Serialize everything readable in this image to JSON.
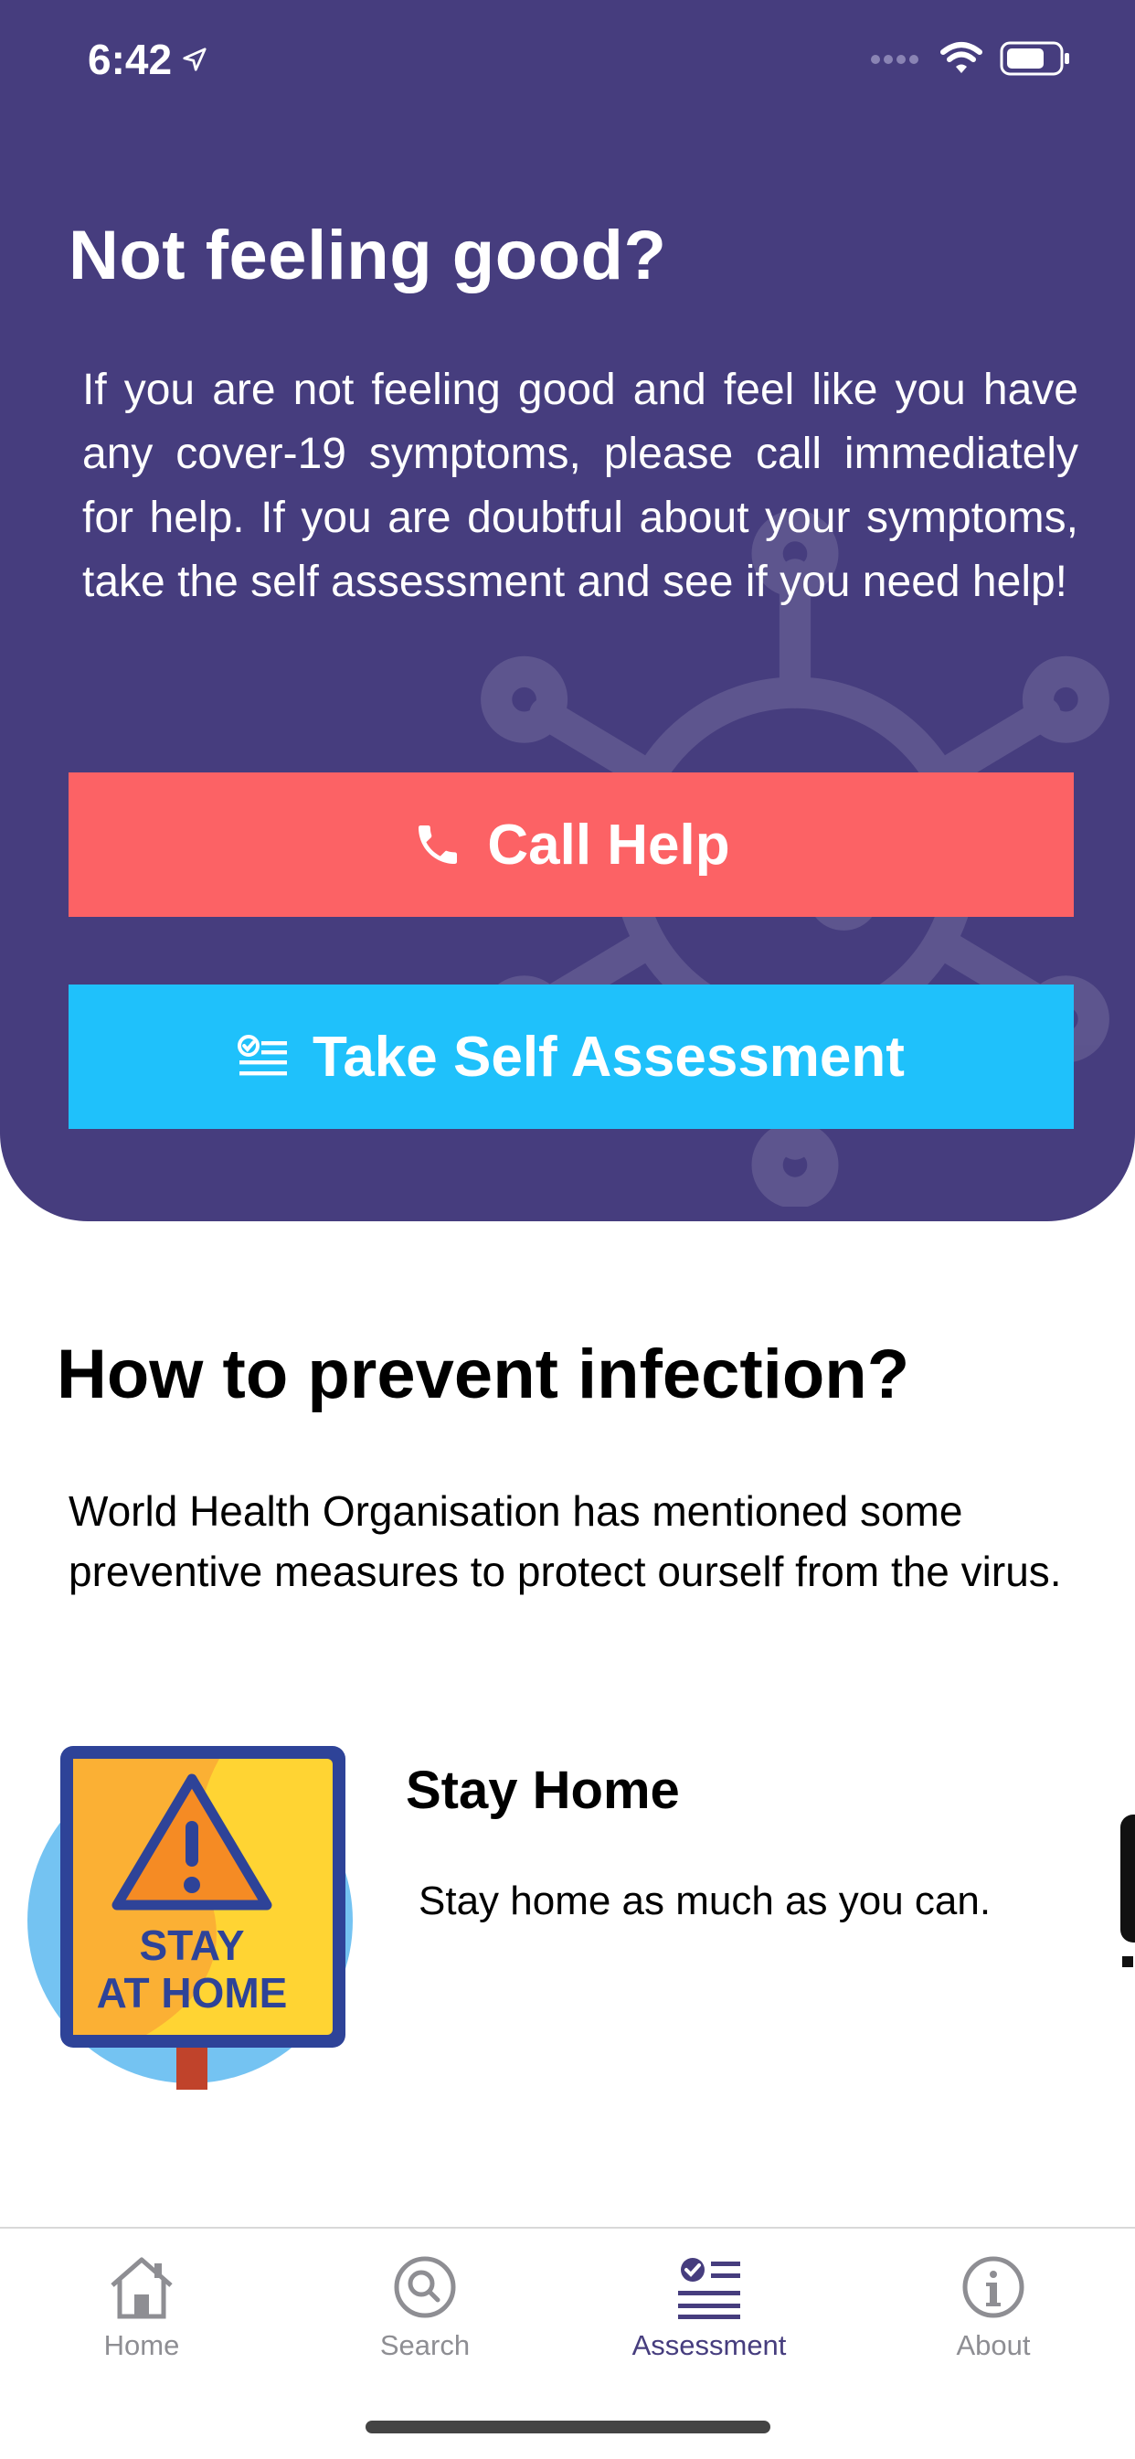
{
  "status_bar": {
    "time": "6:42"
  },
  "hero": {
    "title": "Not feeling good?",
    "description": "If you are not feeling good and feel like you have any cover-19 symptoms, please call immediately for help. If you are doubtful about your symptoms, take the self assessment and see if you need help!",
    "call_button": "Call Help",
    "assess_button": "Take Self Assessment",
    "colors": {
      "background": "#463d7e",
      "call": "#fc6265",
      "assess": "#1fc1fb"
    }
  },
  "prevention": {
    "title": "How to prevent infection?",
    "description": "World Health Organisation has mentioned some preventive measures to protect ourself from the virus.",
    "cards": [
      {
        "title": "Stay Home",
        "text": "Stay home as much as you can.",
        "sign_line1": "STAY",
        "sign_line2": "AT HOME",
        "icon": "stay-at-home-sign-icon"
      }
    ]
  },
  "tabs": [
    {
      "label": "Home",
      "icon": "home-icon",
      "active": false
    },
    {
      "label": "Search",
      "icon": "search-icon",
      "active": false
    },
    {
      "label": "Assessment",
      "icon": "checklist-icon",
      "active": true
    },
    {
      "label": "About",
      "icon": "info-icon",
      "active": false
    }
  ]
}
